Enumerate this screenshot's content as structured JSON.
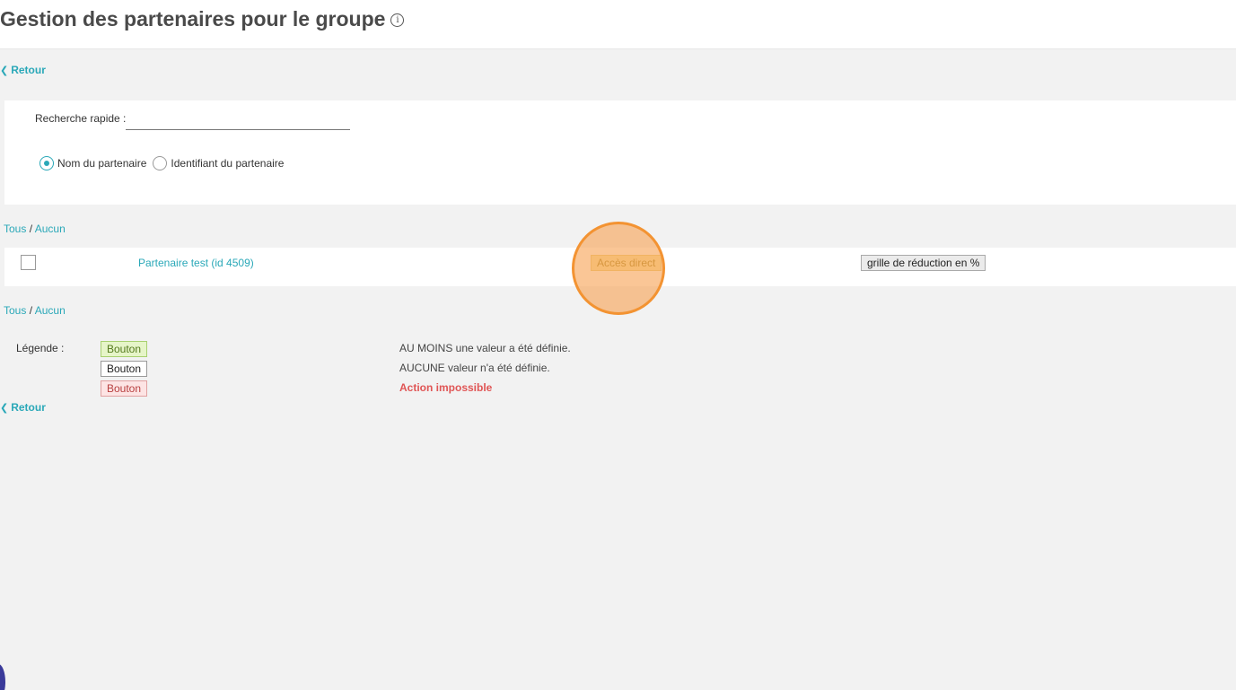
{
  "header": {
    "title": "Gestion des partenaires pour le groupe",
    "info_icon": "info-icon"
  },
  "nav": {
    "back_label": "Retour"
  },
  "search": {
    "label": "Recherche rapide :",
    "value": "",
    "placeholder": "",
    "options": [
      {
        "label": "Nom du partenaire",
        "checked": true
      },
      {
        "label": "Identifiant du partenaire",
        "checked": false
      }
    ]
  },
  "selection": {
    "all": "Tous",
    "separator": "/",
    "none": "Aucun"
  },
  "partners": [
    {
      "name": "Partenaire test (id 4509)",
      "checked": false,
      "access_button": "Accès direct",
      "grid_button": "grille de réduction en %"
    }
  ],
  "legend": {
    "label": "Légende :",
    "items": [
      {
        "button": "Bouton",
        "description": "AU MOINS une valeur a été définie.",
        "color": "#e6f5c8"
      },
      {
        "button": "Bouton",
        "description": "AUCUNE valeur n'a été définie.",
        "color": "#ffffff"
      },
      {
        "button": "Bouton",
        "description": "Action impossible",
        "color": "#fde4e4"
      }
    ]
  },
  "colors": {
    "accent": "#2aa8b8",
    "highlight": "#f39332"
  }
}
